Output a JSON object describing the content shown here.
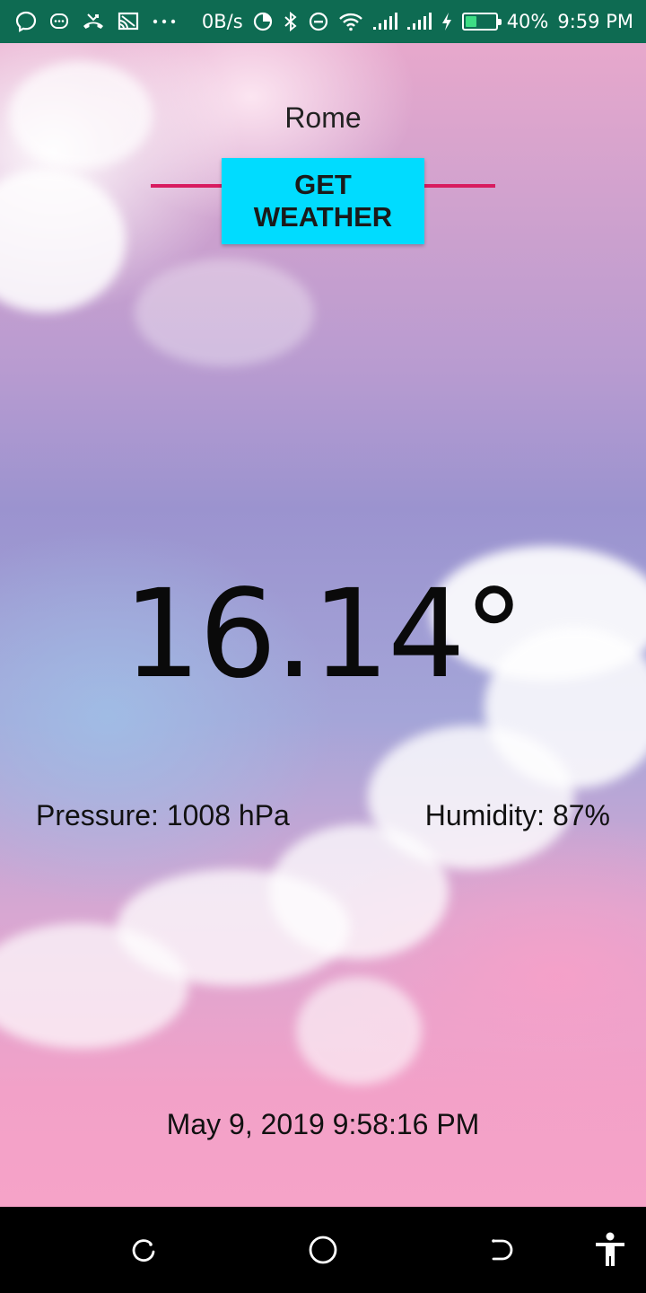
{
  "status_bar": {
    "network_speed": "0B/s",
    "battery_percent": "40%",
    "battery_level": 0.4,
    "time": "9:59 PM",
    "left_icons": [
      "messenger-icon",
      "chat-bubble-icon",
      "missed-call-icon",
      "cast-icon",
      "more-notifications-icon"
    ],
    "right_icons": [
      "data-saver-icon",
      "bluetooth-icon",
      "do-not-disturb-icon",
      "wifi-icon",
      "signal-icon",
      "signal-icon",
      "charging-icon",
      "battery-icon"
    ],
    "colors": {
      "background": "#0e6b52",
      "foreground": "#ffffff"
    }
  },
  "city_input": {
    "value": "Rome",
    "underline_color": "#d81b60"
  },
  "get_weather_button": {
    "label": "GET WEATHER",
    "color": "#00dcff"
  },
  "weather": {
    "temperature": "16.14°",
    "pressure": "Pressure: 1008 hPa",
    "humidity": "Humidity: 87%",
    "updated": "May 9, 2019 9:58:16 PM"
  },
  "nav_bar": {
    "buttons": [
      "recents-icon",
      "home-icon",
      "back-icon",
      "accessibility-icon"
    ]
  }
}
